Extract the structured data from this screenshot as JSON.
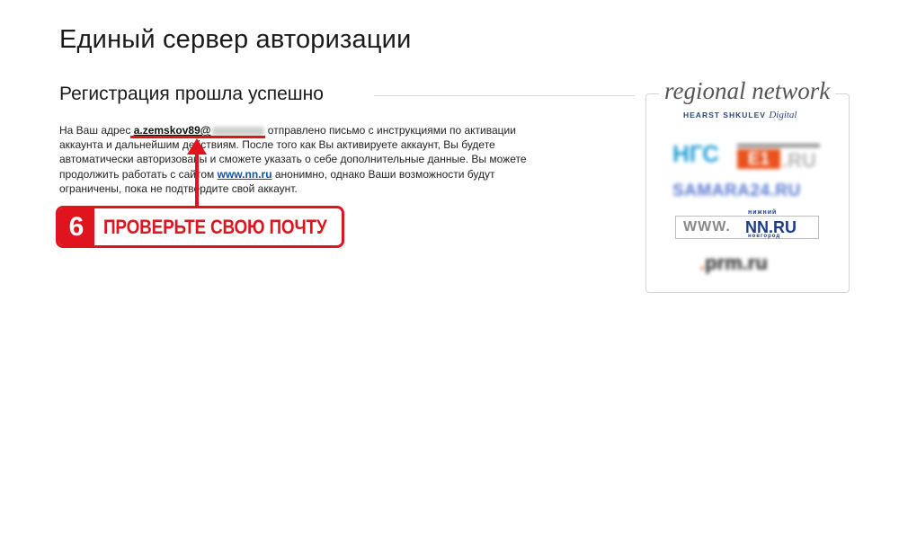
{
  "header": {
    "page_title": "Единый сервер авторизации",
    "section_title": "Регистрация прошла успешно"
  },
  "message": {
    "prefix": "На Ваш адрес",
    "email": "a.zemskov89@",
    "part1": "отправлено письмо с инструкциями по активации аккаунта и дальнейшим действиям. После того как Вы активируете аккаунт, Вы будете автоматически авторизованы и сможете указать о себе дополнительные данные. Вы можете продолжить работать с сайтом",
    "site_link": "www.nn.ru",
    "part2": "анонимно, однако Ваши возможности будут ограничены, пока не подтвердите свой аккаунт."
  },
  "annotation": {
    "step_number": "6",
    "text": "ПРОВЕРЬТЕ СВОЮ ПОЧТУ",
    "color": "#e0141e"
  },
  "partners": {
    "title": "regional network",
    "subtitle": "HEARST SHKULEV",
    "subtitle_italic": "Digital",
    "logos": {
      "ngs": "НГС",
      "e1_box": "E1",
      "e1_ru": ".RU",
      "samara": "SAMARA24.RU",
      "nn_www": "WWW.",
      "nn_main": "NN.RU",
      "nn_top": "нижний",
      "nn_bottom": "новгород",
      "prm_dot": ".",
      "prm_main": "prm.ru"
    }
  }
}
